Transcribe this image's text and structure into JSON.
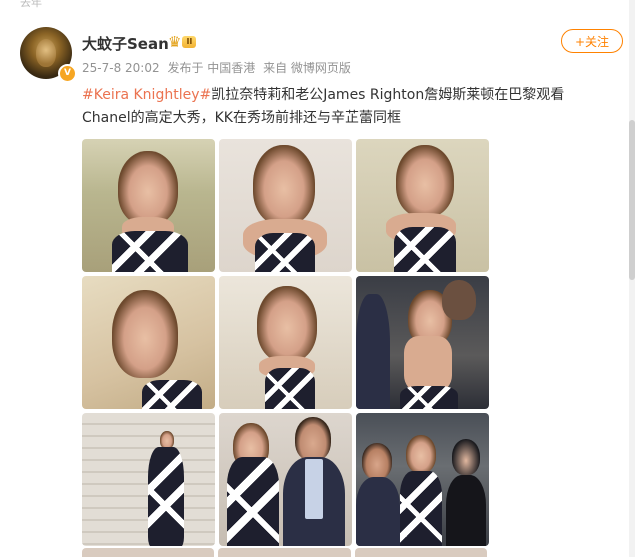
{
  "top_fade_text": "去年",
  "post": {
    "username": "大蚊子Sean",
    "verified_badge": "V",
    "level_badge": "II",
    "time": "25-7-8 20:02",
    "location": "发布于 中国香港",
    "source": "来自 微博网页版",
    "follow_label": "+关注",
    "topic": "#Keira Knightley#",
    "text": "凯拉奈特莉和老公James Righton詹姆斯莱顿在巴黎观看Chanel的高定大秀，KK在秀场前排还与辛芷蕾同框"
  },
  "photos": [
    {
      "name": "photo-1",
      "scene": "portrait-garden"
    },
    {
      "name": "photo-2",
      "scene": "portrait-wall"
    },
    {
      "name": "photo-3",
      "scene": "portrait-garden-side"
    },
    {
      "name": "photo-4",
      "scene": "closeup-left"
    },
    {
      "name": "photo-5",
      "scene": "closeup-terrace"
    },
    {
      "name": "photo-6",
      "scene": "back-view"
    },
    {
      "name": "photo-7",
      "scene": "staircase-full"
    },
    {
      "name": "photo-8",
      "scene": "couple"
    },
    {
      "name": "photo-9",
      "scene": "front-row"
    }
  ],
  "colors": {
    "topic": "#eb7350",
    "follow": "#ff8200",
    "meta": "#939393",
    "verified": "#f6a623"
  }
}
